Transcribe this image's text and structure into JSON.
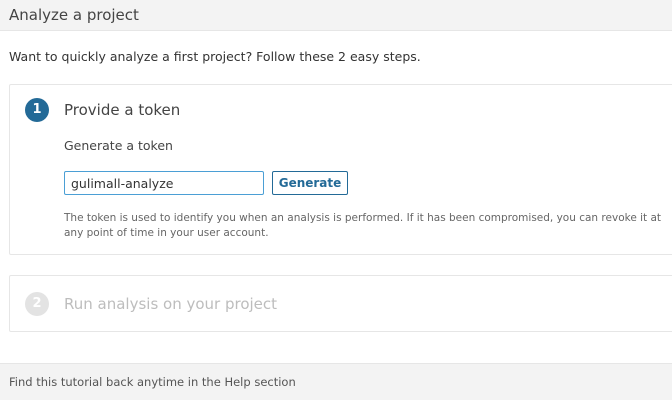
{
  "header": {
    "title": "Analyze a project"
  },
  "intro": {
    "text": "Want to quickly analyze a first project? Follow these 2 easy steps."
  },
  "steps": [
    {
      "number": "1",
      "title": "Provide a token",
      "sub_label": "Generate a token",
      "token_input": {
        "value": "gulimall-analyze",
        "placeholder": ""
      },
      "generate_label": "Generate",
      "help_text": "The token is used to identify you when an analysis is performed. If it has been compromised, you can revoke it at any point of time in your user account."
    },
    {
      "number": "2",
      "title": "Run analysis on your project"
    }
  ],
  "footer": {
    "text": "Find this tutorial back anytime in the Help section"
  },
  "colors": {
    "accent": "#236a97",
    "input_focus_border": "#4b9fd5",
    "inactive_step": "#e3e3e3",
    "inactive_text": "#bdbdbd",
    "header_bg": "#f3f3f3"
  }
}
